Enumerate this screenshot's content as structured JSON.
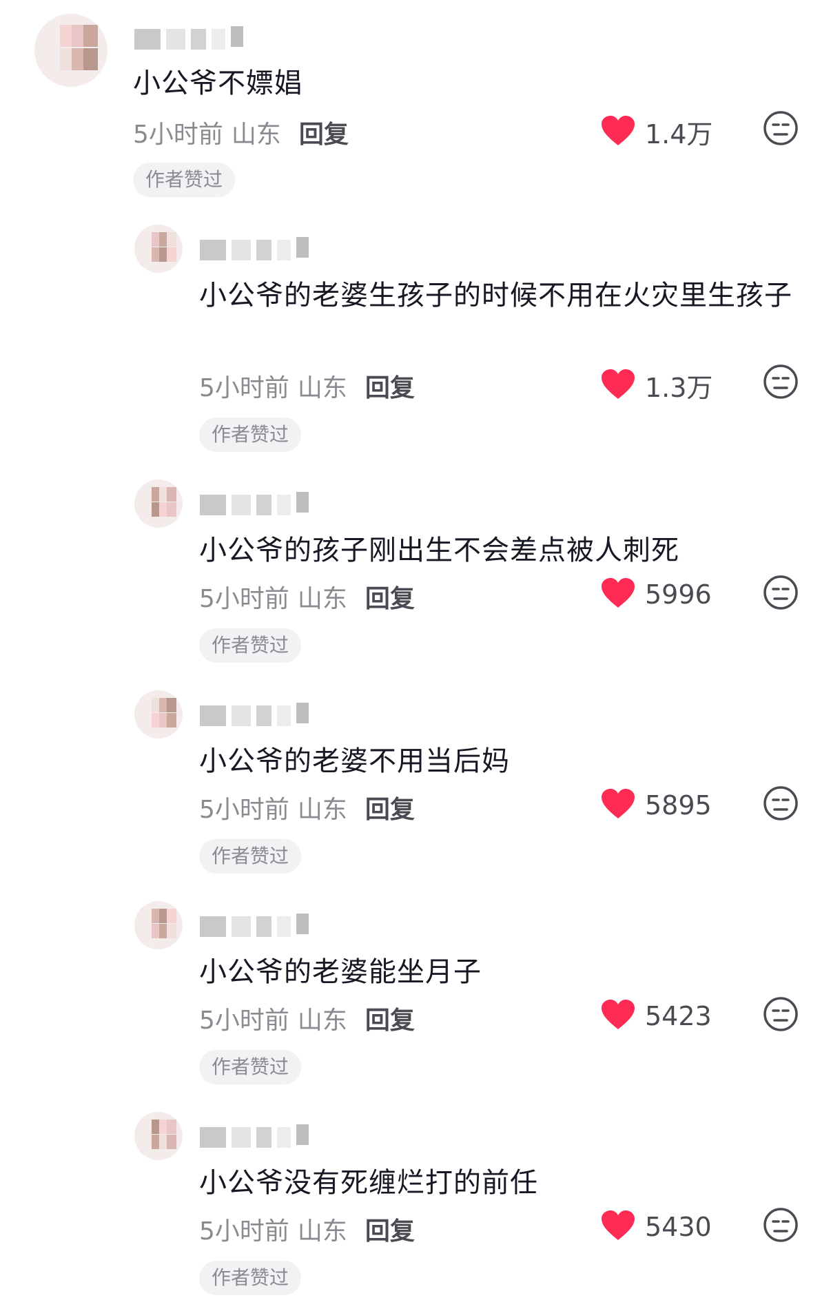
{
  "colors": {
    "like": "#fe2c55",
    "meta": "#8a8b91",
    "badge_bg": "#f2f2f4"
  },
  "icons": {
    "like": "heart-icon",
    "dislike": "meh-face-icon"
  },
  "comments": [
    {
      "text": "小公爷不嫖娼",
      "time": "5小时前",
      "location": "山东",
      "reply": "回复",
      "likes": "1.4万",
      "badge": "作者赞过"
    },
    {
      "text": "小公爷的老婆生孩子的时候不用在火灾里生孩子",
      "time": "5小时前",
      "location": "山东",
      "reply": "回复",
      "likes": "1.3万",
      "badge": "作者赞过"
    },
    {
      "text": "小公爷的孩子刚出生不会差点被人刺死",
      "time": "5小时前",
      "location": "山东",
      "reply": "回复",
      "likes": "5996",
      "badge": "作者赞过"
    },
    {
      "text": "小公爷的老婆不用当后妈",
      "time": "5小时前",
      "location": "山东",
      "reply": "回复",
      "likes": "5895",
      "badge": "作者赞过"
    },
    {
      "text": "小公爷的老婆能坐月子",
      "time": "5小时前",
      "location": "山东",
      "reply": "回复",
      "likes": "5423",
      "badge": "作者赞过"
    },
    {
      "text": "小公爷没有死缠烂打的前任",
      "time": "5小时前",
      "location": "山东",
      "reply": "回复",
      "likes": "5430",
      "badge": "作者赞过"
    }
  ]
}
